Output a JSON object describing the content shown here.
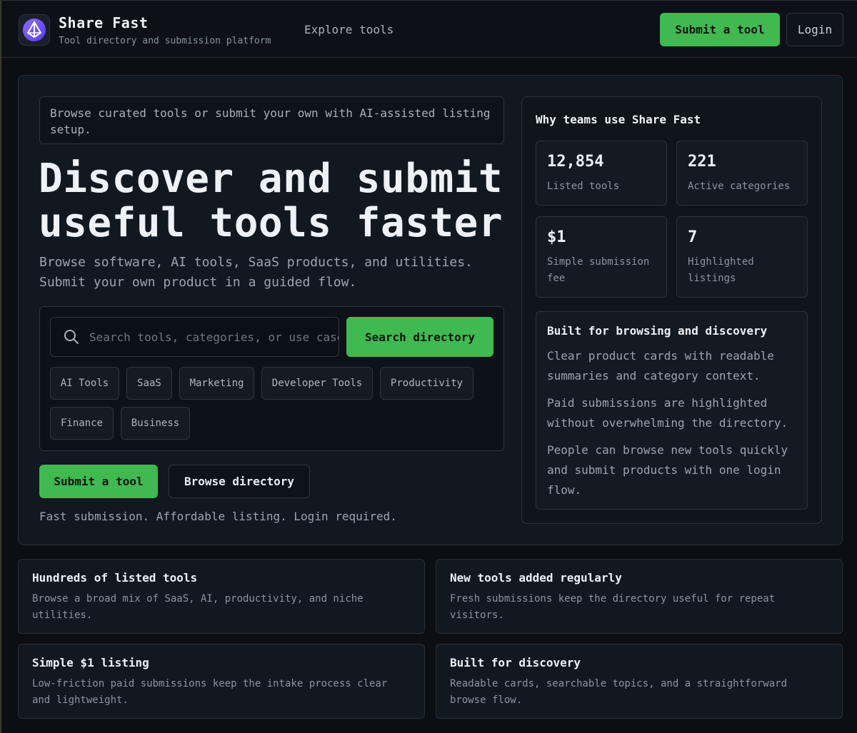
{
  "header": {
    "brand_name": "Share Fast",
    "brand_subtitle": "Tool directory and submission platform",
    "nav_explore": "Explore tools",
    "submit_button": "Submit a tool",
    "login_button": "Login",
    "accent_color": "#3fb950",
    "logo_color": "#7c5cff"
  },
  "hero": {
    "eyebrow": "Browse curated tools or submit your own with AI-assisted listing setup.",
    "title_line1": "Discover and submit",
    "title_line2": "useful tools faster",
    "subtitle_line1": "Browse software, AI tools, SaaS products, and utilities.",
    "subtitle_line2": "Submit your own product in a guided flow.",
    "search": {
      "placeholder": "Search tools, categories, or use cases",
      "button": "Search directory"
    },
    "categories": [
      "AI Tools",
      "SaaS",
      "Marketing",
      "Developer Tools",
      "Productivity",
      "Finance",
      "Business"
    ],
    "submit_button": "Submit a tool",
    "browse_button": "Browse directory",
    "note": "Fast submission. Affordable listing. Login required."
  },
  "side": {
    "title": "Why teams use Share Fast",
    "stats": [
      {
        "value": "12,854",
        "label": "Listed tools"
      },
      {
        "value": "221",
        "label": "Active categories"
      },
      {
        "value": "$1",
        "label": "Simple submission fee"
      },
      {
        "value": "7",
        "label": "Highlighted listings"
      }
    ],
    "built": {
      "title": "Built for browsing and discovery",
      "paragraphs": [
        "Clear product cards with readable summaries and category context.",
        "Paid submissions are highlighted without overwhelming the directory.",
        "People can browse new tools quickly and submit products with one login flow."
      ]
    }
  },
  "features": [
    {
      "title": "Hundreds of listed tools",
      "description": "Browse a broad mix of SaaS, AI, productivity, and niche utilities."
    },
    {
      "title": "New tools added regularly",
      "description": "Fresh submissions keep the directory useful for repeat visitors."
    },
    {
      "title": "Simple $1 listing",
      "description": "Low-friction paid submissions keep the intake process clear and lightweight."
    },
    {
      "title": "Built for discovery",
      "description": "Readable cards, searchable topics, and a straightforward browse flow."
    }
  ]
}
